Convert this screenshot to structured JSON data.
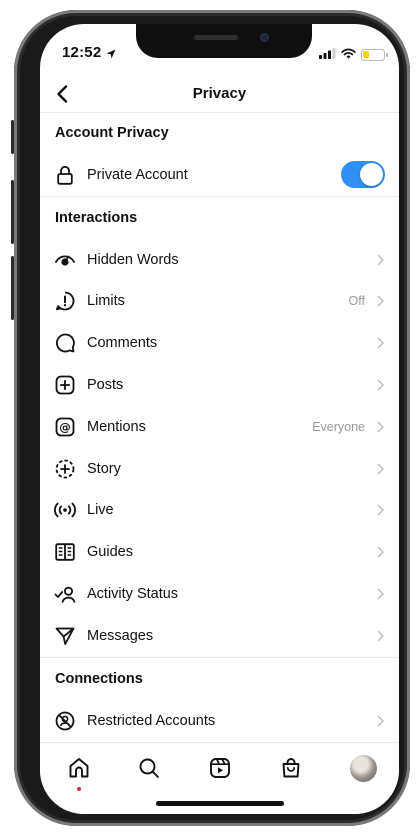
{
  "status_bar": {
    "time": "12:52"
  },
  "header": {
    "title": "Privacy"
  },
  "sections": {
    "account_privacy": {
      "title": "Account Privacy",
      "private_account": {
        "label": "Private Account",
        "enabled": true
      }
    },
    "interactions": {
      "title": "Interactions",
      "items": [
        {
          "label": "Hidden Words",
          "value": "",
          "icon": "eye-icon"
        },
        {
          "label": "Limits",
          "value": "Off",
          "icon": "limits-icon"
        },
        {
          "label": "Comments",
          "value": "",
          "icon": "comment-bubble-icon"
        },
        {
          "label": "Posts",
          "value": "",
          "icon": "plus-square-icon"
        },
        {
          "label": "Mentions",
          "value": "Everyone",
          "icon": "at-sign-icon"
        },
        {
          "label": "Story",
          "value": "",
          "icon": "story-plus-icon"
        },
        {
          "label": "Live",
          "value": "",
          "icon": "live-broadcast-icon"
        },
        {
          "label": "Guides",
          "value": "",
          "icon": "guides-book-icon"
        },
        {
          "label": "Activity Status",
          "value": "",
          "icon": "activity-status-icon"
        },
        {
          "label": "Messages",
          "value": "",
          "icon": "send-icon"
        }
      ]
    },
    "connections": {
      "title": "Connections",
      "items": [
        {
          "label": "Restricted Accounts",
          "value": "",
          "icon": "restricted-icon"
        }
      ]
    }
  },
  "bottom_nav": [
    "home-icon",
    "search-icon",
    "reels-icon",
    "shop-bag-icon",
    "profile-avatar"
  ],
  "colors": {
    "toggle_on": "#2f8ff5",
    "notification_dot": "#e02a3c",
    "battery_low": "#f6d21a"
  }
}
